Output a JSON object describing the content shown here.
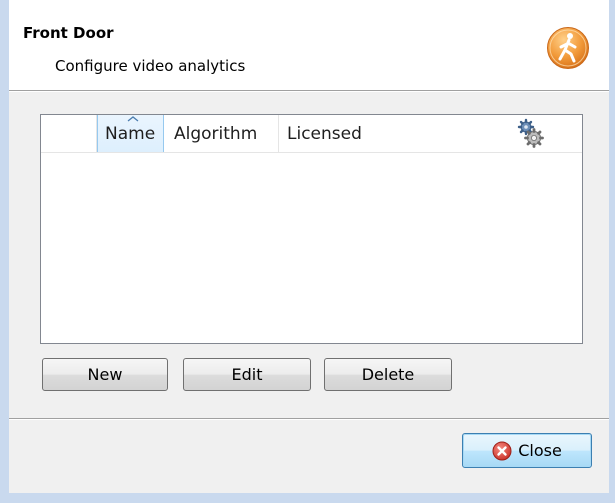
{
  "header": {
    "title": "Front Door",
    "subtitle": "Configure video analytics",
    "icon": "pedestrian-icon",
    "icon_color": "#f29b3b"
  },
  "list": {
    "columns": [
      "",
      "Name",
      "Algorithm",
      "Licensed"
    ],
    "sorted_column": "Name",
    "sort_direction": "ascending",
    "rows": [],
    "settings_icon": "gear-icon"
  },
  "buttons": {
    "new_label": "New",
    "edit_label": "Edit",
    "delete_label": "Delete",
    "close_label": "Close",
    "close_icon": "close-circle-icon"
  },
  "colors": {
    "header_bg": "#ffffff",
    "dialog_bg": "#f0f0f0",
    "accent_blue": "#3c7fb1",
    "close_red": "#d9453c"
  }
}
